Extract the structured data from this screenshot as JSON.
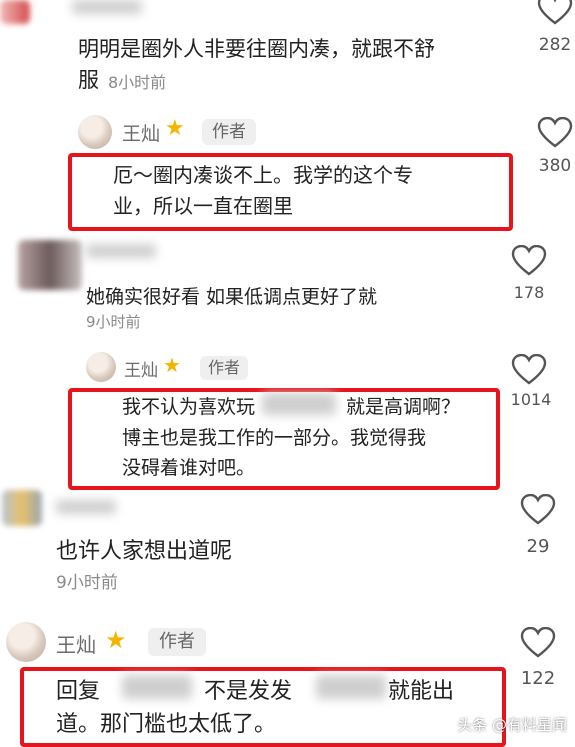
{
  "comments": [
    {
      "text_line1": "明明是圈外人非要往圈内凑，就跟不舒",
      "text_line2": "服",
      "time": "8小时前",
      "likes": "282"
    },
    {
      "name": "王灿",
      "tag": "作者",
      "text_line1": "厄～圈内凑谈不上。我学的这个专",
      "text_line2": "业，所以一直在圈里",
      "likes": "380"
    },
    {
      "text_line1": "她确实很好看 如果低调点更好了就",
      "time": "9小时前",
      "likes": "178"
    },
    {
      "name": "王灿",
      "tag": "作者",
      "text_line1a": "我不认为喜欢玩",
      "text_line1b": "就是高调啊？",
      "text_line2": "博主也是我工作的一部分。我觉得我",
      "text_line3": "没碍着谁对吧。",
      "likes": "1014"
    },
    {
      "text_line1": "也许人家想出道呢",
      "time": "9小时前",
      "likes": "29"
    },
    {
      "name": "王灿",
      "tag": "作者",
      "text_line1a": "回复",
      "text_line1b": "不是发发",
      "text_line1c": "就能出",
      "text_line2": "道。那门槛也太低了。",
      "likes": "122"
    }
  ],
  "watermark": "头条 @有料星闻",
  "colors": {
    "highlight_border": "#e8141b",
    "star": "#f4b400"
  },
  "icons": [
    "heart-outline-icon",
    "star-icon"
  ]
}
